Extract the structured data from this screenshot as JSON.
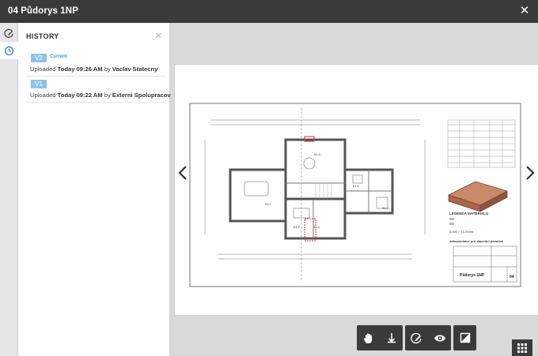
{
  "window": {
    "title": "04 Půdorys 1NP",
    "close_icon": "close-icon"
  },
  "rail": [
    {
      "name": "markup-icon",
      "active": false
    },
    {
      "name": "history-clock-icon",
      "active": true
    }
  ],
  "history": {
    "title": "HISTORY",
    "versions": [
      {
        "badge": "V2",
        "status": "Current",
        "uploaded_prefix": "Uploaded",
        "time": "Today 09:26 AM",
        "by": "by",
        "user": "Vaclav Statecny"
      },
      {
        "badge": "V1",
        "status": "",
        "uploaded_prefix": "Uploaded",
        "time": "Today 09:22 AM",
        "by": "by",
        "user": "Externi Spolupracovnik"
      }
    ]
  },
  "drawing": {
    "rooms": [
      "01.6",
      "01.1",
      "01.5",
      "01.3",
      "01.4",
      "01.2"
    ],
    "legend_title": "LEGENDA MATERIÁLŮ",
    "elevation": "0.000 = 10,000m",
    "doc_type": "dokumentace pro stavební povolení",
    "sheet_title": "Půdorys 1NP",
    "sheet_number": "04"
  },
  "toolbar": {
    "groups": [
      [
        "hand-pan-icon",
        "download-icon"
      ],
      [
        "markup-pen-icon",
        "eye-icon"
      ],
      [
        "compare-icon"
      ]
    ],
    "grid": "grid-icon"
  },
  "colors": {
    "titlebar": "#3a3a3a",
    "accent": "#3a9ad9",
    "badge": "#8fc3e9"
  }
}
